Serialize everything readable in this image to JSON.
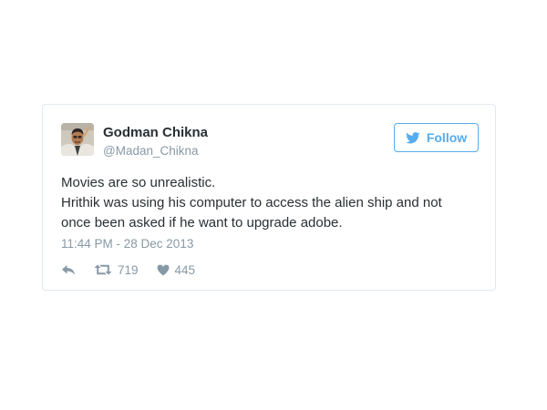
{
  "tweet": {
    "author": {
      "display_name": "Godman Chikna",
      "screen_name": "@Madan_Chikna",
      "avatar_icon": "profile-photo"
    },
    "follow_button": {
      "label": "Follow",
      "icon": "twitter-bird-icon"
    },
    "text_lines": [
      "Movies are so unrealistic.",
      "Hrithik was using his computer to access the alien ship and not",
      "once been asked if he want to upgrade adobe."
    ],
    "timestamp": "11:44 PM - 28 Dec 2013",
    "actions": {
      "reply": {
        "icon": "reply-icon"
      },
      "retweet": {
        "icon": "retweet-icon",
        "count": "719"
      },
      "like": {
        "icon": "heart-icon",
        "count": "445"
      }
    }
  },
  "colors": {
    "accent": "#55acee",
    "text": "#292f33",
    "muted": "#8899a6",
    "border": "#e1e8ed"
  }
}
